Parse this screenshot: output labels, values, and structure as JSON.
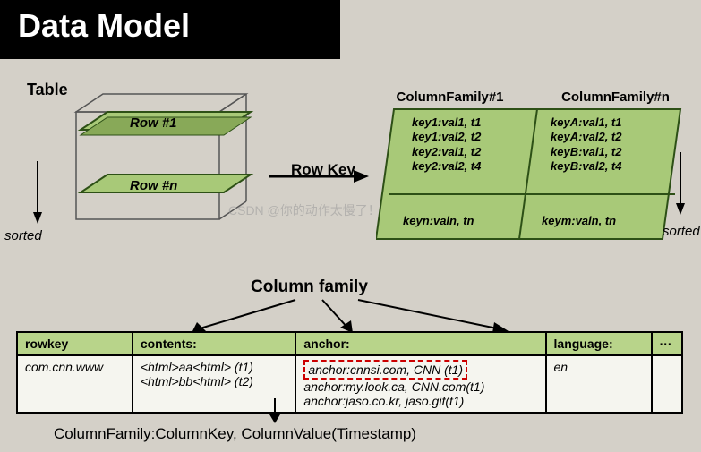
{
  "title": "Data Model",
  "labels": {
    "table": "Table",
    "row1": "Row #1",
    "rown": "Row #n",
    "sorted_left": "sorted",
    "sorted_right": "sorted",
    "rowkey": "Row Key",
    "column_family": "Column family",
    "cf1": "ColumnFamily#1",
    "cfn": "ColumnFamily#n"
  },
  "cf_cells": {
    "tl": "key1:val1, t1\nkey1:val2, t2\nkey2:val1, t2\nkey2:val2, t4",
    "tr": "keyA:val1, t1\nkeyA:val2, t2\nkeyB:val1, t2\nkeyB:val2, t4",
    "bl": "keyn:valn, tn",
    "br": "keym:valn, tn"
  },
  "table_headers": {
    "rowkey": "rowkey",
    "contents": "contents:",
    "anchor": "anchor:",
    "language": "language:",
    "dots": "···"
  },
  "table_row": {
    "rowkey": "com.cnn.www",
    "contents_l1": "<html>aa<html> (t1)",
    "contents_l2": "<html>bb<html> (t2)",
    "anchor_l1": "anchor:cnnsi.com, CNN (t1)",
    "anchor_l2": "anchor:my.look.ca, CNN.com(t1)",
    "anchor_l3": "anchor:jaso.co.kr, jaso.gif(t1)",
    "language": "en"
  },
  "footer": "ColumnFamily:ColumnKey, ColumnValue(Timestamp)",
  "watermark": "CSDN @你的动作太慢了！"
}
